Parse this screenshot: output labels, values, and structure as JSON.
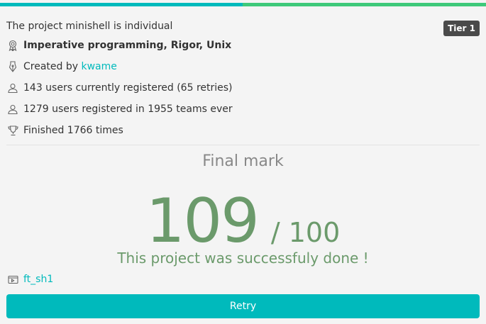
{
  "project": {
    "individual_text": "The project minishell is individual",
    "tier": "Tier 1",
    "skills": "Imperative programming, Rigor, Unix",
    "created_by_prefix": "Created by",
    "creator": "kwame",
    "currently_registered": "143 users currently registered (65 retries)",
    "registered_ever": "1279 users registered in 1955 teams ever",
    "finished": "Finished 1766 times"
  },
  "result": {
    "title": "Final mark",
    "mark": "109",
    "max": "/ 100",
    "message": "This project was successfuly done !"
  },
  "repo": {
    "name": "ft_sh1"
  },
  "actions": {
    "retry_label": "Retry"
  },
  "colors": {
    "accent": "#00babc",
    "success": "#6b9a6b",
    "badge": "#4a4a4a"
  }
}
